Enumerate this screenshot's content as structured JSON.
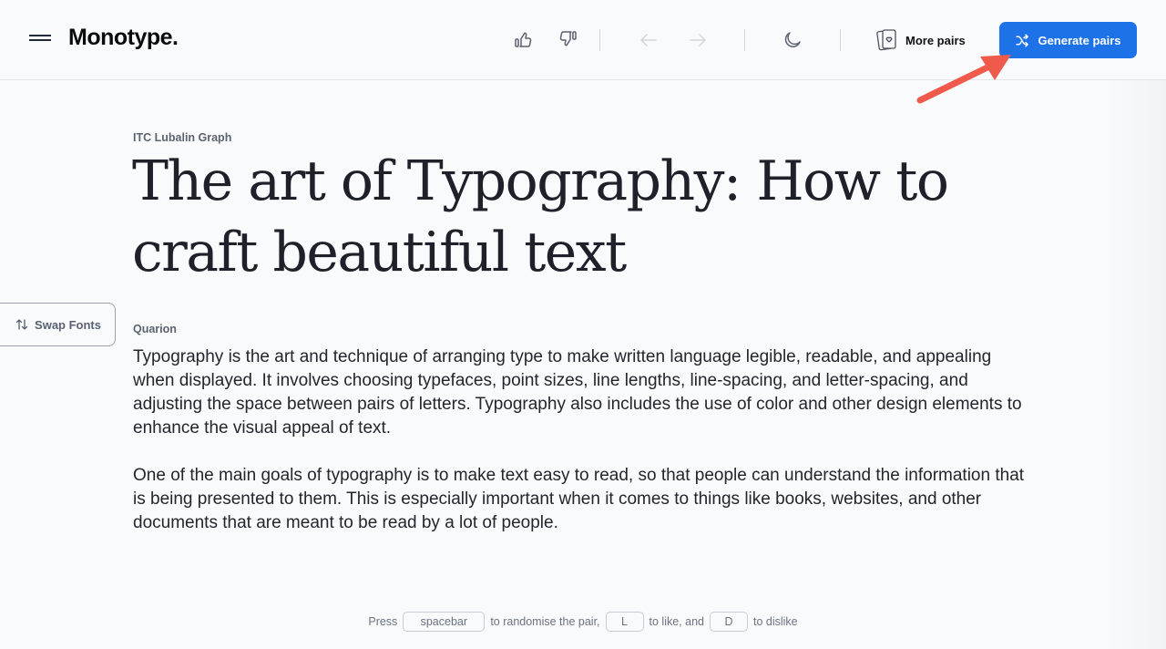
{
  "header": {
    "menu_icon": "hamburger-icon",
    "logo": "Monotype.",
    "actions": {
      "like_icon": "thumbs-up-icon",
      "dislike_icon": "thumbs-down-icon",
      "back_icon": "arrow-left-icon",
      "forward_icon": "arrow-right-icon",
      "theme_icon": "moon-icon",
      "more_pairs_icon": "cards-heart-icon",
      "more_pairs_label": "More pairs",
      "generate_icon": "shuffle-icon",
      "generate_label": "Generate pairs"
    }
  },
  "colors": {
    "accent": "#1d72e8",
    "annotation_arrow": "#ef5a4a",
    "background": "#f8fafc",
    "text": "#1e2129"
  },
  "main": {
    "heading_font": "ITC Lubalin Graph",
    "heading": "The art of Typography: How to craft beautiful text",
    "body_font": "Quarion",
    "paragraphs": [
      "Typography is the art and technique of arranging type to make written language legible, readable, and appealing when displayed. It involves choosing typefaces, point sizes, line lengths, line-spacing, and letter-spacing, and adjusting the space between pairs of letters. Typography also includes the use of color and other design elements to enhance the visual appeal of text.",
      "One of the main goals of typography is to make text easy to read, so that people can understand the information that is being presented to them. This is especially important when it comes to things like books, websites, and other documents that are meant to be read by a lot of people."
    ],
    "swap": {
      "icon": "swap-vertical-icon",
      "label": "Swap Fonts"
    }
  },
  "hint": {
    "press": "Press",
    "key_spacebar": "spacebar",
    "randomise": "to randomise the pair,",
    "key_like": "L",
    "like": "to like, and",
    "key_dislike": "D",
    "dislike": "to dislike"
  }
}
